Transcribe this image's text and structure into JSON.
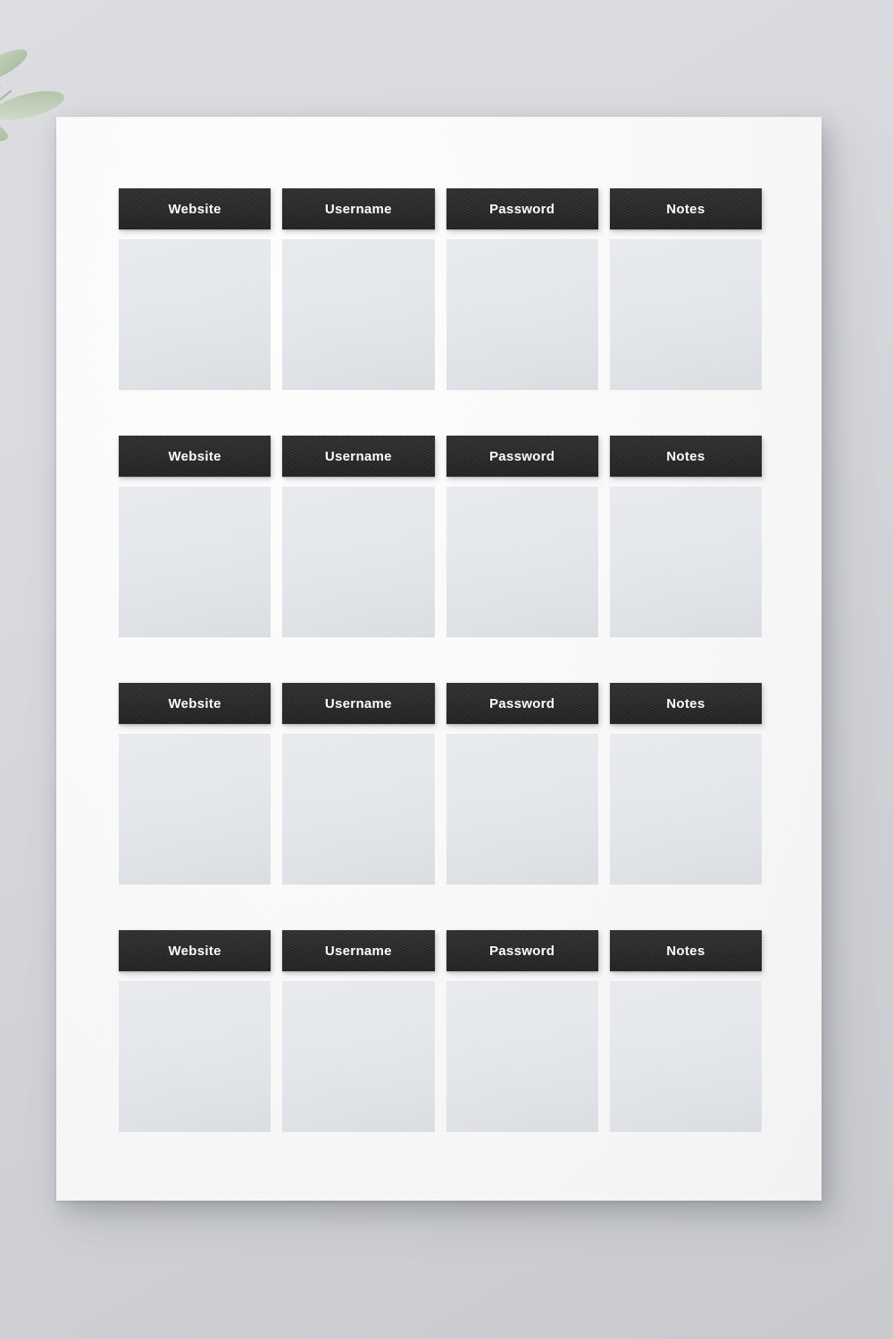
{
  "document": {
    "kind": "password-log-printable-sheet",
    "paper_color": "#fbfbfb",
    "background_color": "#d6d8dd",
    "header_bar_color": "#2b2b2d",
    "header_text_color": "#fcfcfc",
    "field_box_color": "#e2e5ea",
    "accent_color": "#2b2b2d"
  },
  "decoration": {
    "leaf_sprig": {
      "name": "olive-leaf-sprig",
      "color": "#b9c7b0",
      "stem_color": "#a9b8a0"
    }
  },
  "columns": [
    "Website",
    "Username",
    "Password",
    "Notes"
  ],
  "rows": [
    {
      "headers": [
        "Website",
        "Username",
        "Password",
        "Notes"
      ],
      "fields": [
        "",
        "",
        "",
        ""
      ]
    },
    {
      "headers": [
        "Website",
        "Username",
        "Password",
        "Notes"
      ],
      "fields": [
        "",
        "",
        "",
        ""
      ]
    },
    {
      "headers": [
        "Website",
        "Username",
        "Password",
        "Notes"
      ],
      "fields": [
        "",
        "",
        "",
        ""
      ]
    },
    {
      "headers": [
        "Website",
        "Username",
        "Password",
        "Notes"
      ],
      "fields": [
        "",
        "",
        "",
        ""
      ]
    }
  ]
}
